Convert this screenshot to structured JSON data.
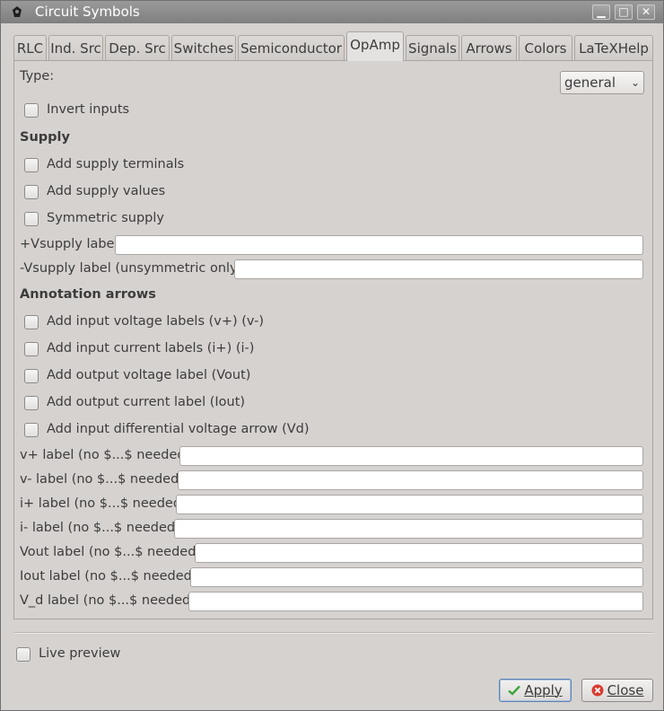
{
  "window": {
    "title": "Circuit Symbols",
    "controls": {
      "minimize": "▁",
      "maximize": "□",
      "close": "✕"
    }
  },
  "tabs": [
    "RLC",
    "Ind. Src",
    "Dep. Src",
    "Switches",
    "Semiconductor",
    "OpAmp",
    "Signals",
    "Arrows",
    "Colors",
    "LaTeXHelp"
  ],
  "active_tab": "OpAmp",
  "form": {
    "type_label": "Type:",
    "type_value": "general",
    "invert_inputs": "Invert inputs",
    "supply_heading": "Supply",
    "add_supply_terminals": "Add supply terminals",
    "add_supply_values": "Add supply values",
    "symmetric_supply": "Symmetric supply",
    "vplus_supply_label": "+Vsupply label",
    "vminus_supply_label": "-Vsupply label (unsymmetric only)",
    "annotation_heading": "Annotation arrows",
    "add_input_voltage": "Add input voltage labels (v+) (v-)",
    "add_input_current": "Add input current labels (i+) (i-)",
    "add_output_voltage": "Add output voltage label (Vout)",
    "add_output_current": "Add output current label (Iout)",
    "add_input_diff": "Add input differential voltage arrow (Vd)",
    "vplus_label": "v+ label (no $...$ needed)",
    "vminus_label": "v- label (no $...$ needed)",
    "iplus_label": "i+ label (no $...$ needed)",
    "iminus_label": "i- label (no $...$ needed)",
    "vout_label": "Vout label (no $...$ needed)",
    "iout_label": "Iout label (no $...$ needed)",
    "vd_label": "V_d label (no $...$ needed)"
  },
  "footer": {
    "live_preview": "Live preview",
    "apply": "Apply",
    "close": "Close"
  },
  "colors": {
    "apply_check": "#3aa53a",
    "close_icon": "#d93a2f"
  }
}
